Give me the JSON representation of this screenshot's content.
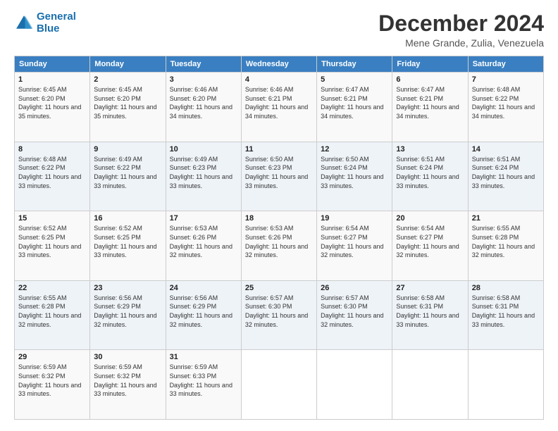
{
  "logo": {
    "line1": "General",
    "line2": "Blue"
  },
  "title": "December 2024",
  "subtitle": "Mene Grande, Zulia, Venezuela",
  "weekdays": [
    "Sunday",
    "Monday",
    "Tuesday",
    "Wednesday",
    "Thursday",
    "Friday",
    "Saturday"
  ],
  "weeks": [
    [
      {
        "day": "1",
        "sunrise": "6:45 AM",
        "sunset": "6:20 PM",
        "daylight": "11 hours and 35 minutes."
      },
      {
        "day": "2",
        "sunrise": "6:45 AM",
        "sunset": "6:20 PM",
        "daylight": "11 hours and 35 minutes."
      },
      {
        "day": "3",
        "sunrise": "6:46 AM",
        "sunset": "6:20 PM",
        "daylight": "11 hours and 34 minutes."
      },
      {
        "day": "4",
        "sunrise": "6:46 AM",
        "sunset": "6:21 PM",
        "daylight": "11 hours and 34 minutes."
      },
      {
        "day": "5",
        "sunrise": "6:47 AM",
        "sunset": "6:21 PM",
        "daylight": "11 hours and 34 minutes."
      },
      {
        "day": "6",
        "sunrise": "6:47 AM",
        "sunset": "6:21 PM",
        "daylight": "11 hours and 34 minutes."
      },
      {
        "day": "7",
        "sunrise": "6:48 AM",
        "sunset": "6:22 PM",
        "daylight": "11 hours and 34 minutes."
      }
    ],
    [
      {
        "day": "8",
        "sunrise": "6:48 AM",
        "sunset": "6:22 PM",
        "daylight": "11 hours and 33 minutes."
      },
      {
        "day": "9",
        "sunrise": "6:49 AM",
        "sunset": "6:22 PM",
        "daylight": "11 hours and 33 minutes."
      },
      {
        "day": "10",
        "sunrise": "6:49 AM",
        "sunset": "6:23 PM",
        "daylight": "11 hours and 33 minutes."
      },
      {
        "day": "11",
        "sunrise": "6:50 AM",
        "sunset": "6:23 PM",
        "daylight": "11 hours and 33 minutes."
      },
      {
        "day": "12",
        "sunrise": "6:50 AM",
        "sunset": "6:24 PM",
        "daylight": "11 hours and 33 minutes."
      },
      {
        "day": "13",
        "sunrise": "6:51 AM",
        "sunset": "6:24 PM",
        "daylight": "11 hours and 33 minutes."
      },
      {
        "day": "14",
        "sunrise": "6:51 AM",
        "sunset": "6:24 PM",
        "daylight": "11 hours and 33 minutes."
      }
    ],
    [
      {
        "day": "15",
        "sunrise": "6:52 AM",
        "sunset": "6:25 PM",
        "daylight": "11 hours and 33 minutes."
      },
      {
        "day": "16",
        "sunrise": "6:52 AM",
        "sunset": "6:25 PM",
        "daylight": "11 hours and 33 minutes."
      },
      {
        "day": "17",
        "sunrise": "6:53 AM",
        "sunset": "6:26 PM",
        "daylight": "11 hours and 32 minutes."
      },
      {
        "day": "18",
        "sunrise": "6:53 AM",
        "sunset": "6:26 PM",
        "daylight": "11 hours and 32 minutes."
      },
      {
        "day": "19",
        "sunrise": "6:54 AM",
        "sunset": "6:27 PM",
        "daylight": "11 hours and 32 minutes."
      },
      {
        "day": "20",
        "sunrise": "6:54 AM",
        "sunset": "6:27 PM",
        "daylight": "11 hours and 32 minutes."
      },
      {
        "day": "21",
        "sunrise": "6:55 AM",
        "sunset": "6:28 PM",
        "daylight": "11 hours and 32 minutes."
      }
    ],
    [
      {
        "day": "22",
        "sunrise": "6:55 AM",
        "sunset": "6:28 PM",
        "daylight": "11 hours and 32 minutes."
      },
      {
        "day": "23",
        "sunrise": "6:56 AM",
        "sunset": "6:29 PM",
        "daylight": "11 hours and 32 minutes."
      },
      {
        "day": "24",
        "sunrise": "6:56 AM",
        "sunset": "6:29 PM",
        "daylight": "11 hours and 32 minutes."
      },
      {
        "day": "25",
        "sunrise": "6:57 AM",
        "sunset": "6:30 PM",
        "daylight": "11 hours and 32 minutes."
      },
      {
        "day": "26",
        "sunrise": "6:57 AM",
        "sunset": "6:30 PM",
        "daylight": "11 hours and 32 minutes."
      },
      {
        "day": "27",
        "sunrise": "6:58 AM",
        "sunset": "6:31 PM",
        "daylight": "11 hours and 33 minutes."
      },
      {
        "day": "28",
        "sunrise": "6:58 AM",
        "sunset": "6:31 PM",
        "daylight": "11 hours and 33 minutes."
      }
    ],
    [
      {
        "day": "29",
        "sunrise": "6:59 AM",
        "sunset": "6:32 PM",
        "daylight": "11 hours and 33 minutes."
      },
      {
        "day": "30",
        "sunrise": "6:59 AM",
        "sunset": "6:32 PM",
        "daylight": "11 hours and 33 minutes."
      },
      {
        "day": "31",
        "sunrise": "6:59 AM",
        "sunset": "6:33 PM",
        "daylight": "11 hours and 33 minutes."
      },
      null,
      null,
      null,
      null
    ]
  ]
}
